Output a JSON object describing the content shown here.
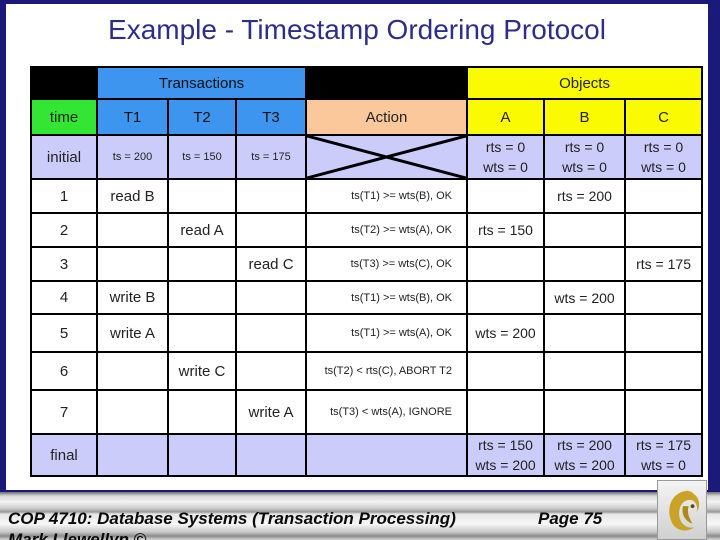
{
  "slide": {
    "title": "Example - Timestamp Ordering Protocol"
  },
  "table": {
    "group_headers": {
      "transactions": "Transactions",
      "objects": "Objects"
    },
    "column_headers": {
      "time": "time",
      "t1": "T1",
      "t2": "T2",
      "t3": "T3",
      "action": "Action",
      "a": "A",
      "b": "B",
      "c": "C"
    },
    "initial": {
      "time": "initial",
      "t1": "ts = 200",
      "t2": "ts = 150",
      "t3": "ts = 175",
      "a": [
        "rts = 0",
        "wts = 0"
      ],
      "b": [
        "rts = 0",
        "wts = 0"
      ],
      "c": [
        "rts = 0",
        "wts = 0"
      ]
    },
    "rows": [
      {
        "time": "1",
        "t1": "read B",
        "t2": "",
        "t3": "",
        "action": "ts(T1) >=  wts(B), OK",
        "a": "",
        "b": "rts = 200",
        "c": ""
      },
      {
        "time": "2",
        "t1": "",
        "t2": "read A",
        "t3": "",
        "action": "ts(T2) >=  wts(A), OK",
        "a": "rts = 150",
        "b": "",
        "c": ""
      },
      {
        "time": "3",
        "t1": "",
        "t2": "",
        "t3": "read C",
        "action": "ts(T3) >=  wts(C), OK",
        "a": "",
        "b": "",
        "c": "rts = 175"
      },
      {
        "time": "4",
        "t1": "write B",
        "t2": "",
        "t3": "",
        "action": "ts(T1) >=  wts(B), OK",
        "a": "",
        "b": "wts = 200",
        "c": ""
      },
      {
        "time": "5",
        "t1": "write A",
        "t2": "",
        "t3": "",
        "action": "ts(T1) >=  wts(A), OK",
        "a": "wts = 200",
        "b": "",
        "c": ""
      },
      {
        "time": "6",
        "t1": "",
        "t2": "write C",
        "t3": "",
        "action": "ts(T2) <  rts(C), ABORT T2",
        "a": "",
        "b": "",
        "c": ""
      },
      {
        "time": "7",
        "t1": "",
        "t2": "",
        "t3": "write A",
        "action": "ts(T3) <  wts(A), IGNORE",
        "a": "",
        "b": "",
        "c": ""
      }
    ],
    "final": {
      "time": "final",
      "a": [
        "rts = 150",
        "wts = 200"
      ],
      "b": [
        "rts = 200",
        "wts = 200"
      ],
      "c": [
        "rts = 175",
        "wts = 0"
      ]
    }
  },
  "footer": {
    "course": "COP 4710: Database Systems  (Transaction Processing)",
    "page": "Page 75",
    "author": "Mark Llewellyn ©",
    "logo_icon": "pegasus-logo-icon"
  },
  "colors": {
    "title": "#2e2e8a",
    "frame": "#1a1a7a",
    "transactions_header": "#3d95f0",
    "objects_header": "#fafa00",
    "time_header": "#33e633",
    "action_header": "#fac89b",
    "initial_final_rows": "#ccccfa"
  }
}
